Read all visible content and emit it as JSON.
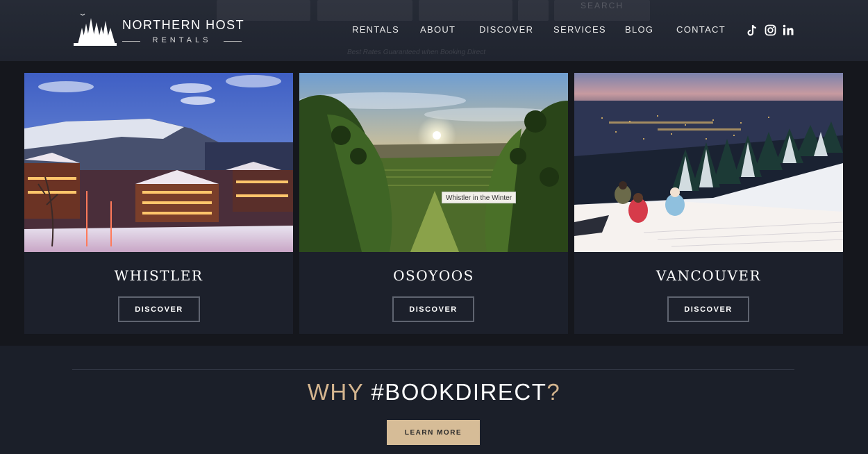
{
  "brand": {
    "name": "NORTHERN HOST",
    "sub": "RENTALS"
  },
  "nav": [
    {
      "label": "RENTALS"
    },
    {
      "label": "ABOUT"
    },
    {
      "label": "DISCOVER"
    },
    {
      "label": "SERVICES"
    },
    {
      "label": "BLOG"
    },
    {
      "label": "CONTACT"
    }
  ],
  "social": [
    "tiktok-icon",
    "instagram-icon",
    "linkedin-icon"
  ],
  "ghost": {
    "search_label": "SEARCH",
    "note": "Best Rates Guaranteed when Booking Direct"
  },
  "destinations": [
    {
      "title": "WHISTLER",
      "button": "DISCOVER"
    },
    {
      "title": "OSOYOOS",
      "button": "DISCOVER"
    },
    {
      "title": "VANCOUVER",
      "button": "DISCOVER"
    }
  ],
  "tooltip": "Whistler in the Winter",
  "why": {
    "part1": "WHY ",
    "part2": "#BOOKDIRECT",
    "part3": "?"
  },
  "learn_more": "LEARN MORE",
  "colors": {
    "accent": "#d4b58f",
    "button_bg": "#d6bc97",
    "panel": "#15171d",
    "card": "#1c202b"
  }
}
